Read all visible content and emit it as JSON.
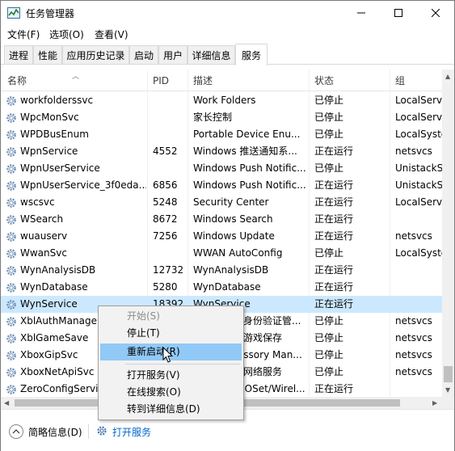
{
  "window": {
    "title": "任务管理器",
    "menu": [
      "文件(F)",
      "选项(O)",
      "查看(V)"
    ]
  },
  "tabs": [
    "进程",
    "性能",
    "应用历史记录",
    "启动",
    "用户",
    "详细信息",
    "服务"
  ],
  "active_tab": "服务",
  "columns": {
    "name": "名称",
    "pid": "PID",
    "desc": "描述",
    "status": "状态",
    "group": "组"
  },
  "rows": [
    {
      "name": "workfolderssvc",
      "pid": "",
      "desc": "Work Folders",
      "status": "已停止",
      "group": "LocalServi"
    },
    {
      "name": "WpcMonSvc",
      "pid": "",
      "desc": "家长控制",
      "status": "已停止",
      "group": "LocalServi"
    },
    {
      "name": "WPDBusEnum",
      "pid": "",
      "desc": "Portable Device Enu...",
      "status": "已停止",
      "group": "LocalSyste"
    },
    {
      "name": "WpnService",
      "pid": "4552",
      "desc": "Windows 推送通知系...",
      "status": "正在运行",
      "group": "netsvcs"
    },
    {
      "name": "WpnUserService",
      "pid": "",
      "desc": "Windows Push Notific...",
      "status": "已停止",
      "group": "UnistackSv"
    },
    {
      "name": "WpnUserService_3f0eda...",
      "pid": "6856",
      "desc": "Windows Push Notific...",
      "status": "正在运行",
      "group": "UnistackSv"
    },
    {
      "name": "wscsvc",
      "pid": "5248",
      "desc": "Security Center",
      "status": "正在运行",
      "group": "LocalServi"
    },
    {
      "name": "WSearch",
      "pid": "8672",
      "desc": "Windows Search",
      "status": "正在运行",
      "group": ""
    },
    {
      "name": "wuauserv",
      "pid": "7256",
      "desc": "Windows Update",
      "status": "正在运行",
      "group": "netsvcs"
    },
    {
      "name": "WwanSvc",
      "pid": "",
      "desc": "WWAN AutoConfig",
      "status": "已停止",
      "group": "LocalSyste"
    },
    {
      "name": "WynAnalysisDB",
      "pid": "12732",
      "desc": "WynAnalysisDB",
      "status": "正在运行",
      "group": ""
    },
    {
      "name": "WynDatabase",
      "pid": "5280",
      "desc": "WynDatabase",
      "status": "正在运行",
      "group": ""
    },
    {
      "name": "WynService",
      "pid": "18392",
      "desc": "WynService",
      "status": "正在运行",
      "group": ""
    },
    {
      "name": "XblAuthManager",
      "pid": "",
      "desc": "Xbox Live 身份验证管...",
      "status": "已停止",
      "group": "netsvcs"
    },
    {
      "name": "XblGameSave",
      "pid": "",
      "desc": "Xbox Live 游戏保存",
      "status": "已停止",
      "group": "netsvcs"
    },
    {
      "name": "XboxGipSvc",
      "pid": "",
      "desc": "Xbox Accessory Man...",
      "status": "已停止",
      "group": "netsvcs"
    },
    {
      "name": "XboxNetApiSvc",
      "pid": "",
      "desc": "Xbox Live 网络服务",
      "status": "已停止",
      "group": "netsvcs"
    },
    {
      "name": "ZeroConfigService",
      "pid": "",
      "desc": "Intel(R) PROSet/Wirel...",
      "status": "正在运行",
      "group": ""
    }
  ],
  "selected_row": "WynService",
  "context_menu": {
    "items": [
      "开始(S)",
      "停止(T)",
      "重新启动(R)",
      "打开服务(V)",
      "在线搜索(O)",
      "转到详细信息(D)"
    ],
    "disabled": "开始(S)",
    "highlighted": "重新启动(R)"
  },
  "bottom": {
    "less_details": "简略信息(D)",
    "open_services": "打开服务"
  },
  "colors": {
    "selection": "#cce8ff",
    "menu_highlight": "#91c9f7",
    "link": "#0066cc"
  },
  "icons": [
    "task-manager-icon",
    "gear-icon",
    "minimize-icon",
    "maximize-icon",
    "close-icon",
    "chevron-up-icon",
    "services-icon",
    "mouse-cursor-icon"
  ]
}
